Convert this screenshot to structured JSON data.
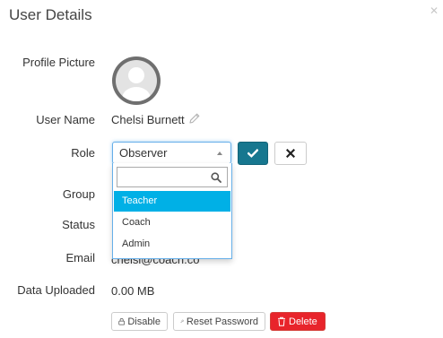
{
  "dialog": {
    "title": "User Details",
    "close_icon": "close-icon"
  },
  "labels": {
    "profile_picture": "Profile Picture",
    "user_name": "User Name",
    "role": "Role",
    "group": "Group",
    "status": "Status",
    "email": "Email",
    "data_uploaded": "Data Uploaded"
  },
  "user": {
    "name": "Chelsi Burnett",
    "email": "chelsi@coach.co",
    "data_uploaded": "0.00 MB"
  },
  "role_select": {
    "selected": "Observer",
    "search_value": "",
    "options": [
      "Teacher",
      "Coach",
      "Admin"
    ],
    "highlighted": "Teacher"
  },
  "actions": {
    "disable": "Disable",
    "reset_password": "Reset Password",
    "delete": "Delete"
  },
  "colors": {
    "confirm_button": "#17778f",
    "highlight_option": "#00b0e6",
    "delete_button": "#e8242b",
    "focus_border": "#66afe9"
  },
  "icons": [
    "close-icon",
    "avatar-icon",
    "pencil-icon",
    "caret-up-icon",
    "check-icon",
    "times-icon",
    "search-icon",
    "lock-icon",
    "key-icon",
    "trash-icon"
  ]
}
